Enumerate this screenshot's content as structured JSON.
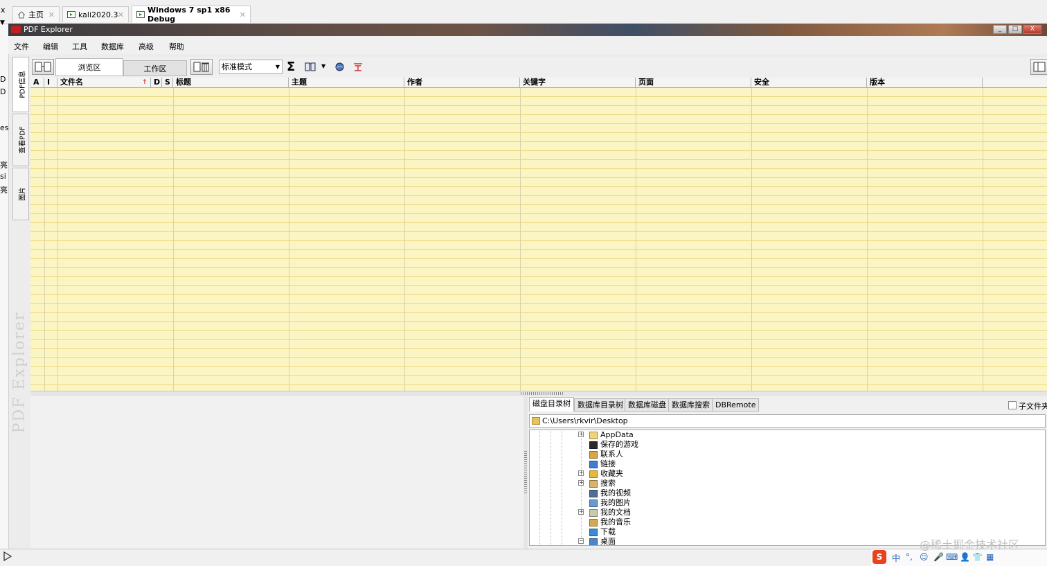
{
  "vm_tabs": [
    {
      "label": "主页",
      "active": false
    },
    {
      "label": "kali2020.3",
      "active": false
    },
    {
      "label": "Windows 7 sp1 x86 Debug",
      "active": true
    }
  ],
  "window": {
    "title": "PDF Explorer",
    "controls": [
      "_",
      "□",
      "X"
    ]
  },
  "menu": [
    "文件",
    "编辑",
    "工具",
    "数据库",
    "高级",
    "帮助"
  ],
  "side_tabs": [
    "PDF信息",
    "查看PDF",
    "图片"
  ],
  "watermark": "PDF Explorer",
  "toolbar": {
    "zone_tabs": [
      {
        "label": "浏览区",
        "active": true
      },
      {
        "label": "工作区",
        "active": false
      }
    ],
    "mode": "标准模式",
    "sigma": "Σ"
  },
  "grid": {
    "columns": [
      "A",
      "I",
      "文件名",
      "D",
      "S",
      "标题",
      "主题",
      "作者",
      "关键字",
      "页面",
      "安全",
      "版本"
    ],
    "sort_indicator": "↑",
    "rows": []
  },
  "bottom_tabs": [
    {
      "label": "磁盘目录树",
      "active": true
    },
    {
      "label": "数据库目录树",
      "active": false
    },
    {
      "label": "数据库磁盘",
      "active": false
    },
    {
      "label": "数据库搜索",
      "active": false
    },
    {
      "label": "DBRemote",
      "active": false
    }
  ],
  "subfolder_label": "子文件夹",
  "path": "C:\\Users\\rkvir\\Desktop",
  "tree": [
    {
      "label": "AppData",
      "expandable": "+",
      "icon": "folder-icon",
      "color": "#f2d37a"
    },
    {
      "label": "保存的游戏",
      "expandable": "",
      "icon": "games-folder-icon",
      "color": "#2a2a2a"
    },
    {
      "label": "联系人",
      "expandable": "",
      "icon": "contacts-folder-icon",
      "color": "#d9a44a"
    },
    {
      "label": "链接",
      "expandable": "",
      "icon": "links-folder-icon",
      "color": "#3f7fd0"
    },
    {
      "label": "收藏夹",
      "expandable": "+",
      "icon": "favorites-folder-icon",
      "color": "#e8b83a"
    },
    {
      "label": "搜索",
      "expandable": "+",
      "icon": "search-folder-icon",
      "color": "#d7b46a"
    },
    {
      "label": "我的视频",
      "expandable": "",
      "icon": "videos-folder-icon",
      "color": "#4f6f9a"
    },
    {
      "label": "我的图片",
      "expandable": "",
      "icon": "pictures-folder-icon",
      "color": "#6a9acd"
    },
    {
      "label": "我的文档",
      "expandable": "+",
      "icon": "documents-folder-icon",
      "color": "#c9c9b0"
    },
    {
      "label": "我的音乐",
      "expandable": "",
      "icon": "music-folder-icon",
      "color": "#d7a94e"
    },
    {
      "label": "下载",
      "expandable": "",
      "icon": "downloads-folder-icon",
      "color": "#3a8ad6"
    },
    {
      "label": "桌面",
      "expandable": "−",
      "icon": "desktop-folder-icon",
      "color": "#4a86c8"
    }
  ],
  "ime": [
    "S",
    "中",
    "°,",
    "☺",
    "🎤",
    "⌨",
    "👤",
    "👕",
    "▦"
  ],
  "credit": "@稀土掘金技术社区",
  "edge_glyphs": [
    "x",
    "D",
    "D",
    "es",
    "亮",
    "si",
    "亮"
  ]
}
